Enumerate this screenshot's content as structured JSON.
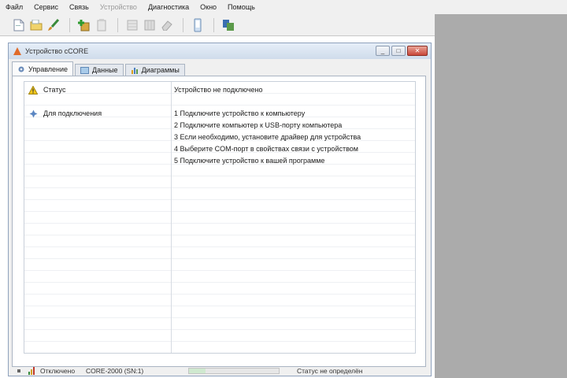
{
  "menu": [
    "Файл",
    "Сервис",
    "Связь",
    "Устройство",
    "Диагностика",
    "Окно",
    "Помощь"
  ],
  "menu_disabled": [
    false,
    false,
    false,
    true,
    false,
    false,
    false
  ],
  "toolbar": {
    "icons": [
      "new-document-icon",
      "open-folder-icon",
      "brush-icon",
      "add-device-icon",
      "clipboard-icon",
      "grid-icon",
      "table-icon",
      "eraser-icon",
      "phone-icon",
      "connect-icon"
    ]
  },
  "window": {
    "title": "Устройство сCORE",
    "controls": {
      "minimize": "_",
      "maximize": "□",
      "close": "✕"
    }
  },
  "tabs": [
    {
      "label": "Управление",
      "icon": "gear-icon",
      "active": true
    },
    {
      "label": "Данные",
      "icon": "data-icon",
      "active": false
    },
    {
      "label": "Диаграммы",
      "icon": "chart-icon",
      "active": false
    }
  ],
  "rows": {
    "status": {
      "name": "Статус",
      "value": "Устройство не подключено",
      "icon": "warning-icon"
    },
    "actions": {
      "name": "Для подключения",
      "icon": "info-icon",
      "steps": [
        "1 Подключите устройство к компьютеру",
        "2 Подключите компьютер к USB-порту компьютера",
        "3 Если необходимо, установите драйвер для устройства",
        "4 Выберите COM-порт в свойствах связи с устройством",
        "5 Подключите устройство к вашей программе"
      ]
    }
  },
  "statusbar": {
    "left": "Отключено",
    "device": "CORE-2000 (SN:1)",
    "right": "Статус не определён",
    "progress": 0.18
  },
  "colors": {
    "accent": "#4a7fbf",
    "warning": "#e6c21a",
    "close": "#c8483a"
  }
}
